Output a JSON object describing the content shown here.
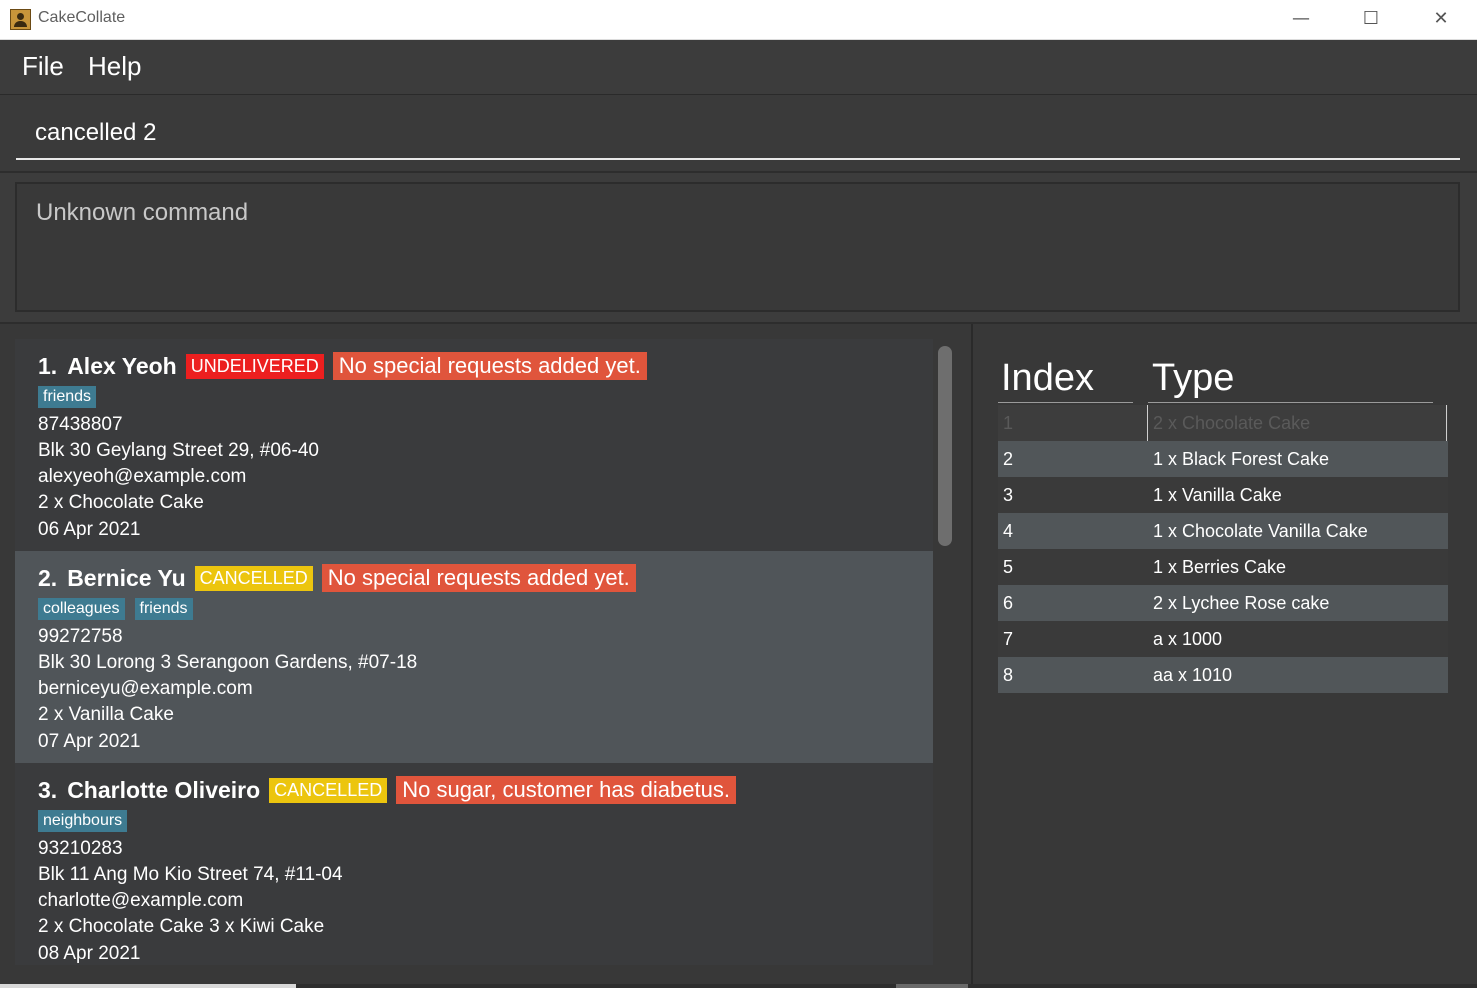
{
  "window": {
    "title": "CakeCollate",
    "minimize": "—",
    "maximize": "☐",
    "close": "✕"
  },
  "menu": {
    "file": "File",
    "help": "Help"
  },
  "command": {
    "value": "cancelled 2"
  },
  "result": {
    "text": "Unknown command"
  },
  "orders": [
    {
      "index": "1.",
      "name": "Alex Yeoh",
      "status": "UNDELIVERED",
      "request": "No special requests added yet.",
      "tags": [
        "friends"
      ],
      "phone": "87438807",
      "address": "Blk 30 Geylang Street 29, #06-40",
      "email": "alexyeoh@example.com",
      "items": "2 x Chocolate Cake",
      "date": "06 Apr 2021"
    },
    {
      "index": "2.",
      "name": "Bernice Yu",
      "status": "CANCELLED",
      "request": "No special requests added yet.",
      "tags": [
        "colleagues",
        "friends"
      ],
      "phone": "99272758",
      "address": "Blk 30 Lorong 3 Serangoon Gardens, #07-18",
      "email": "berniceyu@example.com",
      "items": "2 x Vanilla Cake",
      "date": "07 Apr 2021"
    },
    {
      "index": "3.",
      "name": "Charlotte Oliveiro",
      "status": "CANCELLED",
      "request": "No sugar, customer has diabetus.",
      "tags": [
        "neighbours"
      ],
      "phone": "93210283",
      "address": "Blk 11 Ang Mo Kio Street 74, #11-04",
      "email": "charlotte@example.com",
      "items": "2 x Chocolate Cake 3 x Kiwi Cake",
      "date": "08 Apr 2021"
    }
  ],
  "table": {
    "headers": {
      "index": "Index",
      "type": "Type"
    },
    "rows": [
      {
        "index": "1",
        "type": "2 x Chocolate Cake"
      },
      {
        "index": "2",
        "type": "1 x Black Forest Cake"
      },
      {
        "index": "3",
        "type": "1 x Vanilla Cake"
      },
      {
        "index": "4",
        "type": "1 x Chocolate Vanilla Cake"
      },
      {
        "index": "5",
        "type": "1 x Berries Cake"
      },
      {
        "index": "6",
        "type": "2 x Lychee Rose cake"
      },
      {
        "index": "7",
        "type": "a x 1000"
      },
      {
        "index": "8",
        "type": "aa x 1010"
      }
    ]
  }
}
